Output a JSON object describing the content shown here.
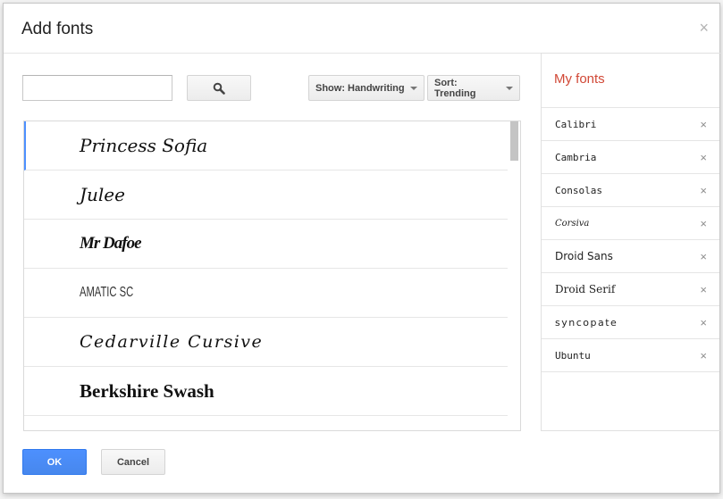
{
  "dialog": {
    "title": "Add fonts",
    "close_label": "×"
  },
  "search": {
    "value": "",
    "placeholder": "",
    "button_icon": "search-icon"
  },
  "filters": {
    "show_label": "Show: Handwriting",
    "sort_label": "Sort: Trending"
  },
  "font_list": {
    "items": [
      {
        "name": "Princess Sofia",
        "selected": true
      },
      {
        "name": "Julee",
        "selected": false
      },
      {
        "name": "Mr Dafoe",
        "selected": false
      },
      {
        "name": "Amatic SC",
        "selected": false
      },
      {
        "name": "Cedarville Cursive",
        "selected": false
      },
      {
        "name": "Berkshire Swash",
        "selected": false
      }
    ]
  },
  "my_fonts": {
    "title": "My fonts",
    "remove_label": "×",
    "items": [
      {
        "name": "Calibri"
      },
      {
        "name": "Cambria"
      },
      {
        "name": "Consolas"
      },
      {
        "name": "Corsiva"
      },
      {
        "name": "Droid Sans"
      },
      {
        "name": "Droid Serif"
      },
      {
        "name": "Syncopate"
      },
      {
        "name": "Ubuntu"
      }
    ]
  },
  "footer": {
    "ok_label": "OK",
    "cancel_label": "Cancel"
  },
  "colors": {
    "accent_blue": "#4d90fe",
    "my_fonts_red": "#d14836"
  }
}
